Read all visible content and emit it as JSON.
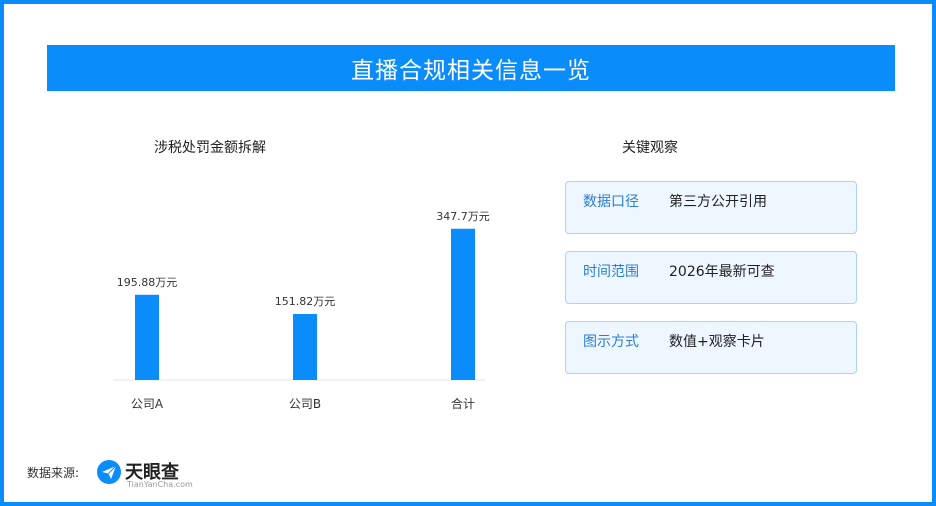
{
  "title": "直播合规相关信息一览",
  "chart_data": {
    "type": "bar",
    "title": "涉税处罚金额拆解",
    "categories": [
      "公司A",
      "公司B",
      "合计"
    ],
    "values": [
      195.88,
      151.82,
      347.7
    ],
    "value_labels": [
      "195.88万元",
      "151.82万元",
      "347.7万元"
    ],
    "ylim": [
      0,
      400
    ],
    "bar_color": "#0A8CFA",
    "grid": false
  },
  "observations": {
    "title": "关键观察",
    "items": [
      {
        "key": "数据口径",
        "value": "第三方公开引用"
      },
      {
        "key": "时间范围",
        "value": "2026年最新可查"
      },
      {
        "key": "图示方式",
        "value": "数值+观察卡片"
      }
    ]
  },
  "footer": {
    "source_label": "数据来源:",
    "logo_text": "天眼查",
    "logo_subtext": "TianYanCha.com"
  },
  "colors": {
    "accent": "#0A8CFA",
    "card_bg": "#EEF6FF",
    "card_border": "#A9D3FB"
  }
}
